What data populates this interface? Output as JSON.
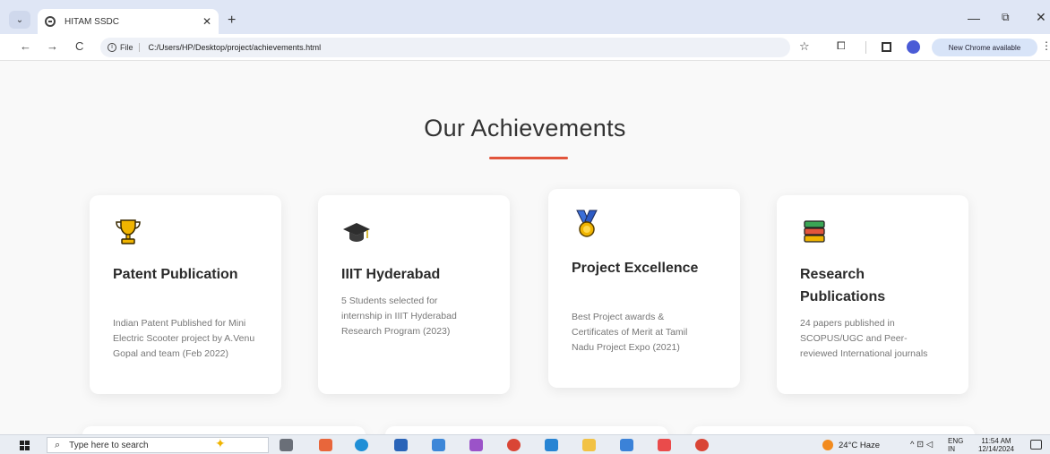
{
  "browser": {
    "tab_title": "HITAM SSDC",
    "tab_close": "✕",
    "new_tab": "+",
    "minimize": "—",
    "restore": "⧉",
    "close": "✕",
    "back": "←",
    "forward": "→",
    "reload": "C",
    "file_chip": "File",
    "url": "C:/Users/HP/Desktop/project/achievements.html",
    "update_label": "New Chrome available",
    "menu": "⋮"
  },
  "page": {
    "heading": "Our Achievements",
    "accent_color": "#e2553c",
    "cards": [
      {
        "icon": "trophy-icon",
        "title": "Patent Publication",
        "description": "Indian Patent Published for Mini Electric Scooter project by A.Venu Gopal and team (Feb 2022)"
      },
      {
        "icon": "graduation-cap-icon",
        "title": "IIIT Hyderabad",
        "description": "5 Students selected for internship in IIIT Hyderabad Research Program (2023)"
      },
      {
        "icon": "medal-icon",
        "title": "Project Excellence",
        "description": "Best Project awards & Certificates of Merit at Tamil Nadu Project Expo (2021)"
      },
      {
        "icon": "books-icon",
        "title": "Research Publications",
        "description": "24 papers published in SCOPUS/UGC and Peer-reviewed International journals"
      }
    ]
  },
  "taskbar": {
    "search_placeholder": "Type here to search",
    "weather": "24°C  Haze",
    "tray": "^  ⊡ ◁",
    "lang_line1": "ENG",
    "lang_line2": "IN",
    "time": "11:54 AM",
    "date": "12/14/2024"
  }
}
